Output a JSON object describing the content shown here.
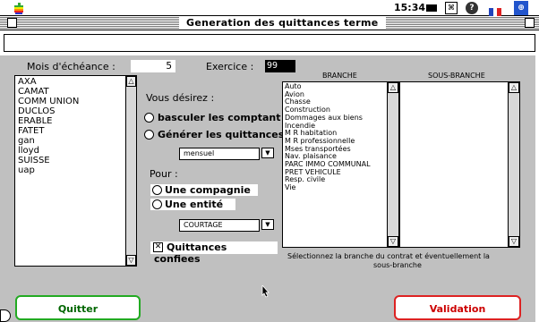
{
  "menubar": {
    "clock": "15:34"
  },
  "window": {
    "title": "Generation des quittances terme",
    "message_field_value": ""
  },
  "form": {
    "mois_label": "Mois d'échéance :",
    "mois_value": "5",
    "exercice_label": "Exercice :",
    "exercice_value": "99",
    "vous_desirez_label": "Vous désirez :",
    "option_basculer": "basculer les comptant",
    "option_generer": "Générer les quittances",
    "periodicity_value": "mensuel",
    "pour_label": "Pour :",
    "option_compagnie": "Une compagnie",
    "option_entite": "Une entité",
    "entity_value": "COURTAGE",
    "checkbox_label": "Quittances confiees",
    "checkbox_checked": true
  },
  "companies": [
    "AXA",
    "CAMAT",
    "COMM UNION",
    "DUCLOS",
    "ERABLE",
    "FATET",
    "gan",
    "lloyd",
    "SUISSE",
    "uap"
  ],
  "branche": {
    "header": "BRANCHE",
    "items": [
      "Auto",
      "Avion",
      "Chasse",
      "Construction",
      "Dommages aux biens",
      "Incendie",
      "M R habitation",
      "M R professionnelle",
      "Mses transportées",
      "Nav. plaisance",
      "PARC IMMO COMMUNAL",
      "PRET VEHICULE",
      "Resp. civile",
      "Vie"
    ]
  },
  "sous_branche": {
    "header": "SOUS-BRANCHE",
    "items": []
  },
  "instruction": {
    "line1": "Sélectionnez la branche du contrat et éventuellement la",
    "line2": "sous-branche"
  },
  "buttons": {
    "quit": "Quitter",
    "validate": "Validation"
  },
  "colors": {
    "quit_border": "#22aa22",
    "validate_border": "#dd2222",
    "validate_text": "#cc0000",
    "quit_text": "#006600",
    "background": "#c0c0c0"
  }
}
